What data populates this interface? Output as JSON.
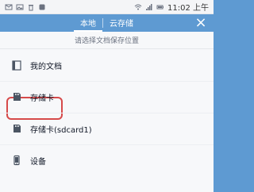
{
  "status_bar": {
    "time": "11:02 上午"
  },
  "top_bar": {
    "tabs": [
      {
        "label": "本地",
        "active": true
      },
      {
        "label": "云存储",
        "active": false
      }
    ],
    "close_icon": "close-icon"
  },
  "panel": {
    "subtitle": "请选择文档保存位置",
    "items": [
      {
        "label": "我的文档",
        "icon": "document-folder-icon"
      },
      {
        "label": "存储卡",
        "icon": "sd-card-icon",
        "highlighted": true
      },
      {
        "label": "存储卡(sdcard1)",
        "icon": "sd-card-icon"
      },
      {
        "label": "设备",
        "icon": "phone-icon"
      }
    ]
  },
  "colors": {
    "accent_blue": "#5e9ad2",
    "highlight_red": "#d64a4a",
    "panel_bg": "#f7f8fa"
  }
}
